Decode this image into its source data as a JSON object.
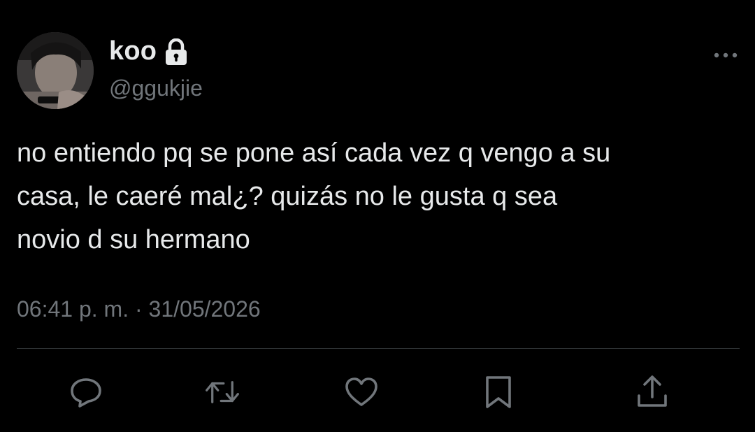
{
  "user": {
    "display_name": "koo",
    "handle": "@ggukjie",
    "protected_icon": "lock-icon",
    "avatar_icon": "avatar-photo"
  },
  "tweet": {
    "text": "no entiendo pq se pone así cada vez q vengo a su\ncasa, le caeré mal¿? quizás no le gusta q sea\nnovio d su hermano",
    "time": "06:41 p. m.",
    "separator": " · ",
    "date": "31/05/2026"
  },
  "actions": [
    {
      "name": "reply",
      "icon": "reply-icon"
    },
    {
      "name": "retweet",
      "icon": "retweet-icon"
    },
    {
      "name": "like",
      "icon": "heart-icon"
    },
    {
      "name": "bookmark",
      "icon": "bookmark-icon"
    },
    {
      "name": "share",
      "icon": "share-icon"
    }
  ],
  "colors": {
    "background": "#000000",
    "primary_text": "#e7e9ea",
    "secondary_text": "#71767b",
    "divider": "#2f3336"
  }
}
